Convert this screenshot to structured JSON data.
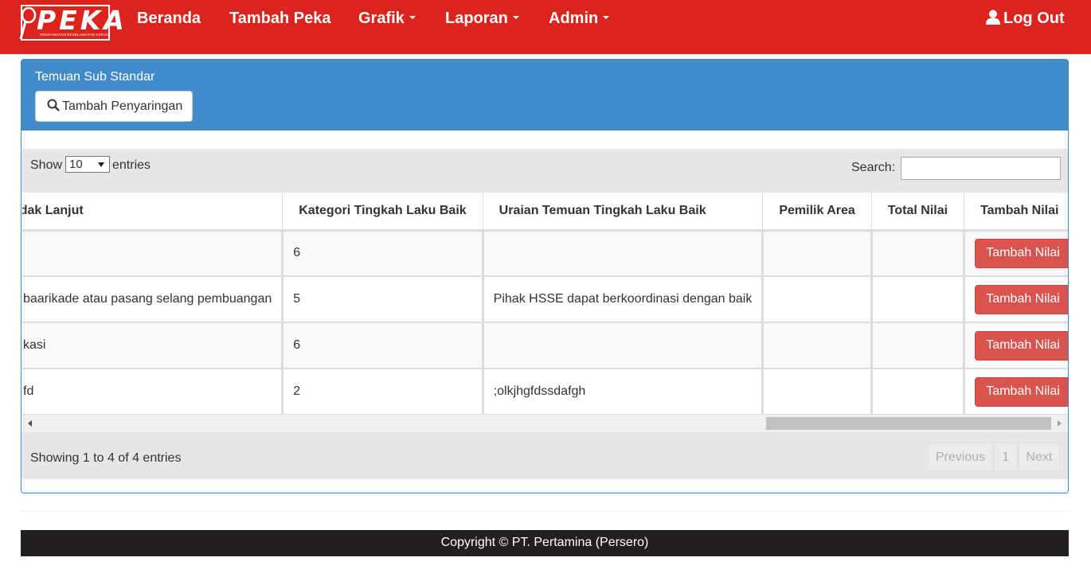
{
  "brand": {
    "logo_text": "PEKA",
    "logo_subtitle": "PENGAMATAN KESELAMATAN KERJA"
  },
  "nav": {
    "items": [
      {
        "label": "Beranda",
        "dropdown": false
      },
      {
        "label": "Tambah Peka",
        "dropdown": false
      },
      {
        "label": "Grafik",
        "dropdown": true
      },
      {
        "label": "Laporan",
        "dropdown": true
      },
      {
        "label": "Admin",
        "dropdown": true
      }
    ],
    "logout_label": "Log Out",
    "logout_icon": "user-icon"
  },
  "panel": {
    "title": "Temuan Sub Standar",
    "filter_button_label": "Tambah Penyaringan",
    "filter_button_icon": "search-icon"
  },
  "datatable": {
    "show_label": "Show",
    "page_length": "10",
    "entries_label": "entries",
    "search_label": "Search:",
    "search_value": "",
    "columns": [
      "Tindak Lanjut",
      "Kategori Tingkah Laku Baik",
      "Uraian Temuan Tingkah Laku Baik",
      "Pemilik Area",
      "Total Nilai",
      "Tambah Nilai"
    ],
    "rows": [
      {
        "tindak_lanjut": "",
        "kategori": "6",
        "uraian": "",
        "pemilik_area": "",
        "total_nilai": "",
        "action": "Tambah Nilai"
      },
      {
        "tindak_lanjut": "baarikade atau pasang selang pembuangan",
        "kategori": "5",
        "uraian": "Pihak HSSE dapat berkoordinasi dengan baik",
        "pemilik_area": "",
        "total_nilai": "",
        "action": "Tambah Nilai"
      },
      {
        "tindak_lanjut": "kasi",
        "kategori": "6",
        "uraian": "",
        "pemilik_area": "",
        "total_nilai": "",
        "action": "Tambah Nilai"
      },
      {
        "tindak_lanjut": "fd",
        "kategori": "2",
        "uraian": ";olkjhgfdssdafgh",
        "pemilik_area": "",
        "total_nilai": "",
        "action": "Tambah Nilai"
      }
    ],
    "info": "Showing 1 to 4 of 4 entries",
    "pagination": {
      "previous": "Previous",
      "page": "1",
      "next": "Next"
    }
  },
  "footer": {
    "copyright": "Copyright © PT. Pertamina (Persero)"
  },
  "colors": {
    "navbar": "#dc241e",
    "panel_header": "#428bca",
    "danger_button": "#d9534f",
    "footer": "#231f20"
  }
}
